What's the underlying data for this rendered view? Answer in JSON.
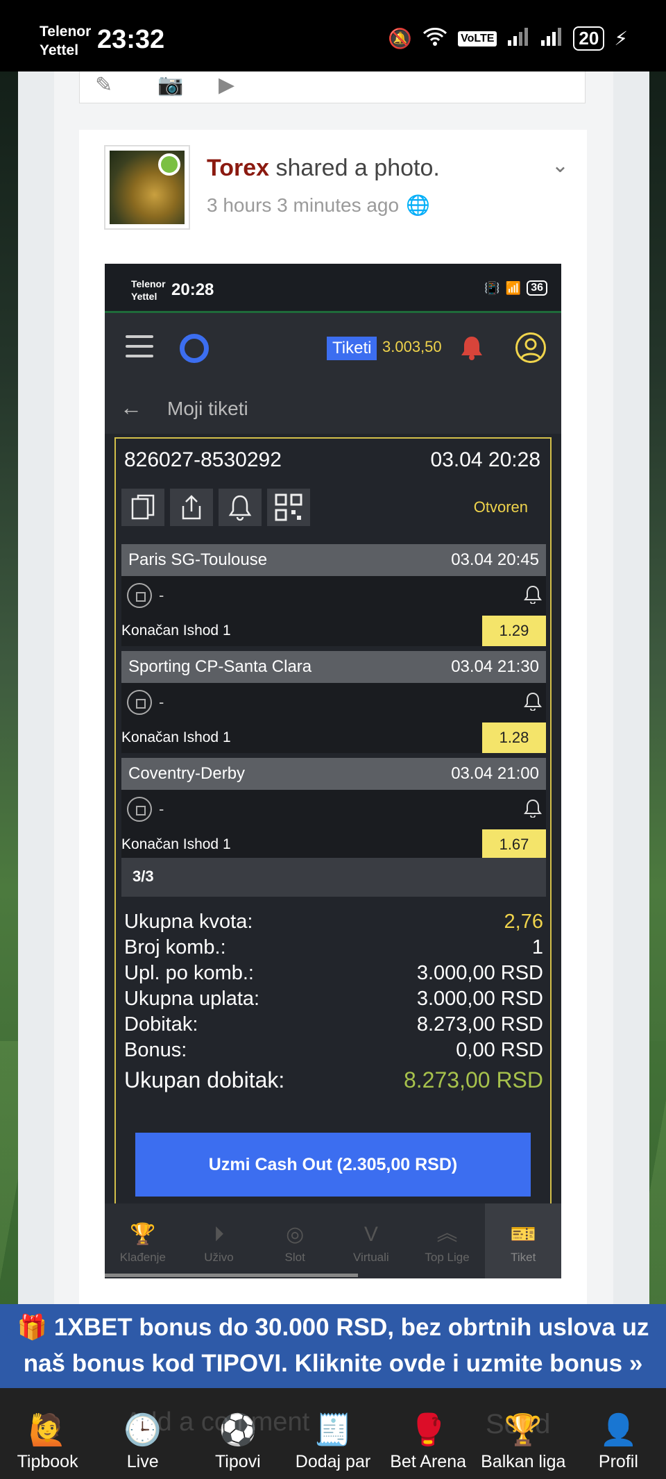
{
  "status_bar": {
    "carrier_line1": "Telenor",
    "carrier_line2": "Yettel",
    "time": "23:32",
    "volte": "VoLTE",
    "battery": "20"
  },
  "post": {
    "author": "Torex",
    "action": " shared a photo.",
    "time_ago": "3 hours 3 minutes ago"
  },
  "screenshot": {
    "status": {
      "carrier_line1": "Telenor",
      "carrier_line2": "Yettel",
      "time": "20:28",
      "battery": "36"
    },
    "nav": {
      "tiketi_label": "Tiketi",
      "balance": "3.003,50"
    },
    "subheader": {
      "back": "←",
      "title": "Moji tiketi"
    },
    "ticket": {
      "id": "826027-8530292",
      "date": "03.04 20:28",
      "state": "Otvoren",
      "matches": [
        {
          "teams": "Paris SG-Toulouse",
          "datetime": "03.04 20:45",
          "score": "-",
          "market": "Konačan Ishod 1",
          "odd": "1.29"
        },
        {
          "teams": "Sporting CP-Santa Clara",
          "datetime": "03.04 21:30",
          "score": "-",
          "market": "Konačan Ishod 1",
          "odd": "1.28"
        },
        {
          "teams": "Coventry-Derby",
          "datetime": "03.04 21:00",
          "score": "-",
          "market": "Konačan Ishod 1",
          "odd": "1.67"
        }
      ],
      "count": "3/3",
      "summary": [
        {
          "label": "Ukupna kvota:",
          "value": "2,76"
        },
        {
          "label": "Broj komb.:",
          "value": "1"
        },
        {
          "label": "Upl. po komb.:",
          "value": "3.000,00 RSD"
        },
        {
          "label": "Ukupna uplata:",
          "value": "3.000,00 RSD"
        },
        {
          "label": "Dobitak:",
          "value": "8.273,00 RSD"
        },
        {
          "label": "Bonus:",
          "value": "0,00 RSD"
        },
        {
          "label": "Ukupan dobitak:",
          "value": "8.273,00 RSD"
        }
      ],
      "cashout_label": "Uzmi Cash Out (2.305,00 RSD)"
    },
    "tabs": [
      {
        "label": "Klađenje",
        "icon": "trophy-icon"
      },
      {
        "label": "Uživo",
        "icon": "play-icon"
      },
      {
        "label": "Slot",
        "icon": "slot-icon"
      },
      {
        "label": "Virtuali",
        "icon": "virtual-icon"
      },
      {
        "label": "Top Lige",
        "icon": "chevrons-up-icon"
      },
      {
        "label": "Tiket",
        "icon": "ticket-icon"
      }
    ]
  },
  "promo": {
    "line1": "🎁 1XBET bonus do 30.000 RSD, bez obrtnih uslova uz",
    "line2": "naš bonus kod TIPOVI. Kliknite ovde i uzmite bonus »"
  },
  "comment_ghost": "Add a comment",
  "send_ghost": "Send",
  "bottom_nav": [
    {
      "label": "Tipbook",
      "icon": "tipster-icon",
      "glyph": "🙋"
    },
    {
      "label": "Live",
      "icon": "clock-icon",
      "glyph": "🕒"
    },
    {
      "label": "Tipovi",
      "icon": "balls-icon",
      "glyph": "⚽"
    },
    {
      "label": "Dodaj par",
      "icon": "betslip-icon",
      "glyph": "🧾"
    },
    {
      "label": "Bet Arena",
      "icon": "boxing-glove-icon",
      "glyph": "🥊"
    },
    {
      "label": "Balkan liga",
      "icon": "trophy-icon",
      "glyph": "🏆"
    },
    {
      "label": "Profil",
      "icon": "user-icon",
      "glyph": "👤"
    }
  ],
  "colors": {
    "accent_blue": "#3c6ef0",
    "odd_yellow": "#f4e46a",
    "gold": "#f0d44c",
    "promo_blue": "#2e5aa8",
    "author_red": "#8b1a10"
  }
}
